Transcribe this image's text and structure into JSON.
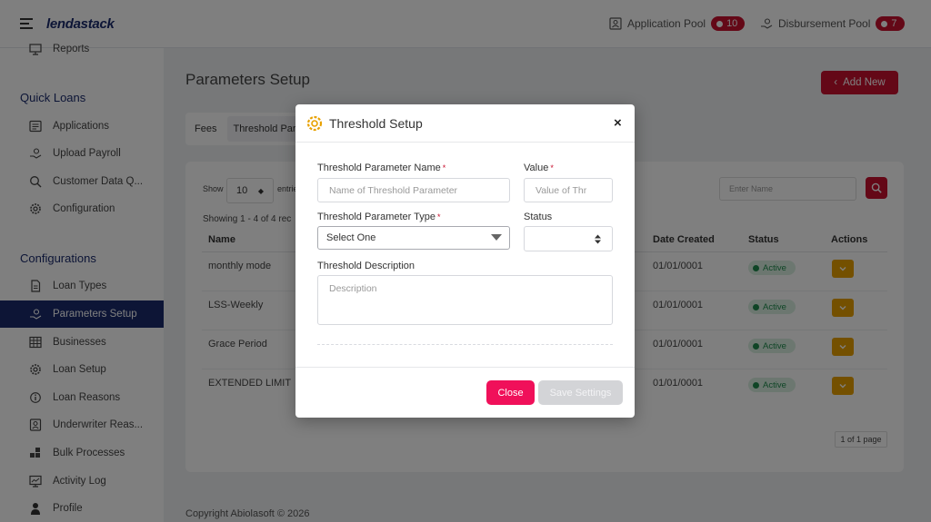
{
  "header": {
    "logo": "lendastack",
    "application_pool": {
      "label": "Application Pool",
      "count": "10"
    },
    "disbursement_pool": {
      "label": "Disbursement Pool",
      "count": "7"
    }
  },
  "sidebar": {
    "partial_item": "Reports",
    "quick_loans": {
      "title": "Quick Loans",
      "items": [
        {
          "label": "Applications",
          "icon": "list-icon"
        },
        {
          "label": "Upload Payroll",
          "icon": "hand-money-icon"
        },
        {
          "label": "Customer Data Q...",
          "icon": "search-icon"
        },
        {
          "label": "Configuration",
          "icon": "gear-icon"
        }
      ]
    },
    "configurations": {
      "title": "Configurations",
      "items": [
        {
          "label": "Loan Types",
          "icon": "document-icon"
        },
        {
          "label": "Parameters Setup",
          "icon": "hand-money-icon",
          "active": true
        },
        {
          "label": "Businesses",
          "icon": "grid-icon"
        },
        {
          "label": "Loan Setup",
          "icon": "gear-icon"
        },
        {
          "label": "Loan Reasons",
          "icon": "info-icon"
        },
        {
          "label": "Underwriter Reas...",
          "icon": "id-card-icon"
        },
        {
          "label": "Bulk Processes",
          "icon": "blocks-icon"
        },
        {
          "label": "Activity Log",
          "icon": "monitor-icon"
        },
        {
          "label": "Profile",
          "icon": "user-icon"
        }
      ]
    }
  },
  "main": {
    "title": "Parameters Setup",
    "add_new": "Add New",
    "tabs": [
      "Fees",
      "Threshold Para"
    ],
    "table": {
      "show_label": "Show",
      "show_value": "10",
      "entries_label": "entrie",
      "showing": "Showing 1 - 4 of 4 rec",
      "search_placeholder": "Enter Name",
      "columns": {
        "name": "Name",
        "date_created": "Date Created",
        "status": "Status",
        "actions": "Actions"
      },
      "rows": [
        {
          "name": "monthly mode",
          "date": "01/01/0001",
          "status": "Active"
        },
        {
          "name": "LSS-Weekly",
          "date": "01/01/0001",
          "status": "Active"
        },
        {
          "name": "Grace Period",
          "date": "01/01/0001",
          "status": "Active"
        },
        {
          "name": "EXTENDED LIMIT",
          "date": "01/01/0001",
          "status": "Active"
        }
      ],
      "pager": "1 of 1 page"
    },
    "footer": "Copyright Abiolasoft © 2026"
  },
  "modal": {
    "title": "Threshold Setup",
    "close_symbol": "×",
    "param_name_label": "Threshold Parameter Name",
    "param_name_placeholder": "Name of Threshold Parameter",
    "value_label": "Value",
    "value_placeholder": "Value of Thr",
    "param_type_label": "Threshold Parameter Type",
    "param_type_value": "Select One",
    "status_label": "Status",
    "description_label": "Threshold Description",
    "description_placeholder": "Description",
    "close_button": "Close",
    "save_button": "Save Settings",
    "required_mark": "*"
  },
  "colors": {
    "brand_navy": "#1a2b6d",
    "brand_red": "#c8102e",
    "close_button": "#f0105a",
    "active_status": "#1e8a4c",
    "action_button": "#e8a100"
  }
}
